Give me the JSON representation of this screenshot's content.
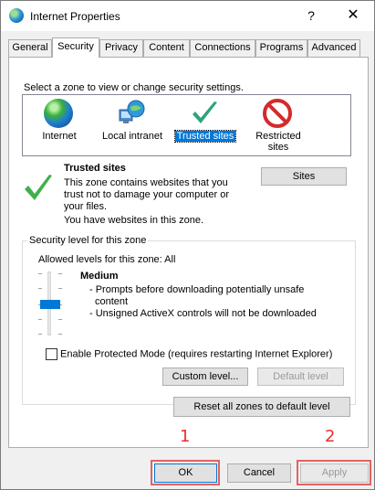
{
  "window": {
    "title": "Internet Properties",
    "help_label": "?",
    "close_label": "✕"
  },
  "tabs": [
    {
      "label": "General"
    },
    {
      "label": "Security"
    },
    {
      "label": "Privacy"
    },
    {
      "label": "Content"
    },
    {
      "label": "Connections"
    },
    {
      "label": "Programs"
    },
    {
      "label": "Advanced"
    }
  ],
  "security": {
    "select_prompt": "Select a zone to view or change security settings.",
    "zones": [
      {
        "label_line1": "Internet",
        "label_line2": "",
        "icon": "globe-icon"
      },
      {
        "label_line1": "Local intranet",
        "label_line2": "",
        "icon": "intranet-icon"
      },
      {
        "label_line1": "Trusted sites",
        "label_line2": "",
        "icon": "check-icon"
      },
      {
        "label_line1": "Restricted",
        "label_line2": "sites",
        "icon": "restricted-icon"
      }
    ],
    "selected_zone": {
      "title": "Trusted sites",
      "desc_line1": "This zone contains websites that you",
      "desc_line2": "trust not to damage your computer or",
      "desc_line3": "your files.",
      "note": "You have websites in this zone."
    },
    "sites_button": "Sites",
    "level_group_title": "Security level for this zone",
    "allowed_levels": "Allowed levels for this zone: All",
    "level_name": "Medium",
    "bullet1_line1": "- Prompts before downloading potentially unsafe",
    "bullet1_line2": "content",
    "bullet2": "- Unsigned ActiveX controls will not be downloaded",
    "protected_mode_label": "Enable Protected Mode (requires restarting Internet Explorer)",
    "protected_mode_checked": false,
    "custom_level_button": "Custom level...",
    "default_level_button": "Default level",
    "reset_all_button": "Reset all zones to default level"
  },
  "footer": {
    "ok_button": "OK",
    "cancel_button": "Cancel",
    "apply_button": "Apply"
  },
  "annotations": {
    "marker1": "1",
    "marker2": "2",
    "color": "#e8302a"
  },
  "colors": {
    "accent": "#0078d7",
    "highlight_box": "#e36262"
  }
}
